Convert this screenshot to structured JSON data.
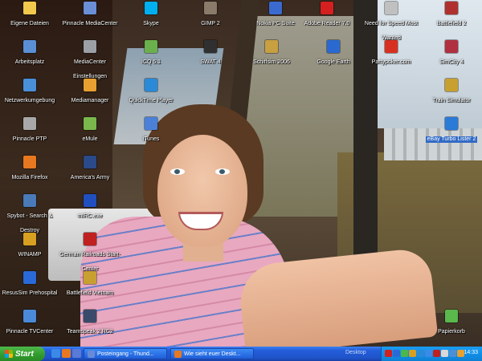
{
  "desktop_icons": [
    {
      "label": "Eigene Dateien",
      "color": "#f2c94c"
    },
    {
      "label": "Pinnacle MediaCenter",
      "color": "#6a8fd6"
    },
    {
      "label": "Skype",
      "color": "#00aff0"
    },
    {
      "label": "GIMP 2",
      "color": "#8a7a6a"
    },
    {
      "label": "Nokia PC Suite",
      "color": "#3a6ad0"
    },
    {
      "label": "Adobe Reader 7.0",
      "color": "#d42020"
    },
    {
      "label": "Need for Speed Most Wanted",
      "color": "#c0c0c0"
    },
    {
      "label": "Battlefield 2",
      "color": "#b03030"
    },
    {
      "label": "Arbeitsplatz",
      "color": "#5a8fd6"
    },
    {
      "label": "MediaCenter Einstellungen",
      "color": "#9aa0a6"
    },
    {
      "label": "ICQ 5.1",
      "color": "#6ab04c"
    },
    {
      "label": "SWAT 4",
      "color": "#303030"
    },
    {
      "label": "Schiffsim 2006",
      "color": "#c8a040"
    },
    {
      "label": "Google Earth",
      "color": "#2a6ad0"
    },
    {
      "label": "Partypoker.com",
      "color": "#d83020"
    },
    {
      "label": "SimCity 4",
      "color": "#b03040"
    },
    {
      "label": "Netzwerkumgebung",
      "color": "#4a90d9"
    },
    {
      "label": "Mediamanager",
      "color": "#e8a030"
    },
    {
      "label": "QuickTime Player",
      "color": "#2a8ad8"
    },
    {
      "label": "Train Simulator",
      "color": "#c8a030"
    },
    {
      "label": "Pinnacle PTP",
      "color": "#a8a8a8"
    },
    {
      "label": "eMule",
      "color": "#7ab84c"
    },
    {
      "label": "iTunes",
      "color": "#4a80d8"
    },
    {
      "label": "eBay Turbo Lister 2",
      "color": "#2a7ad8"
    },
    {
      "label": "Mozilla Firefox",
      "color": "#e87820"
    },
    {
      "label": "America's Army",
      "color": "#2a4a8a"
    },
    {
      "label": "Spybot - Search & Destroy",
      "color": "#4a7ab8"
    },
    {
      "label": "mIRC.exe",
      "color": "#2050c0"
    },
    {
      "label": "WINAMP",
      "color": "#d8a020"
    },
    {
      "label": "German Railroads Start-Center",
      "color": "#c02020"
    },
    {
      "label": "ResusSim Prehospital",
      "color": "#2a6ad8"
    },
    {
      "label": "Battlefield Vietnam",
      "color": "#c8a030"
    },
    {
      "label": "Pinnacle TVCenter",
      "color": "#4a8ad8"
    },
    {
      "label": "Teamspeak 2 RC2",
      "color": "#3a4a6a"
    },
    {
      "label": "Papierkorb",
      "color": "#5ab84c"
    }
  ],
  "taskbar": {
    "start_label": "Start",
    "quicklaunch": [
      {
        "name": "ie-icon",
        "color": "#3a8ae8"
      },
      {
        "name": "firefox-icon",
        "color": "#e87820"
      },
      {
        "name": "thunderbird-icon",
        "color": "#5a7ad8"
      }
    ],
    "tasks": [
      {
        "label": "Posteingang - Thund...",
        "color": "#6a8ad8"
      },
      {
        "label": "Wie sieht euer Deskt...",
        "color": "#e87820"
      }
    ],
    "desktop_label": "Desktop",
    "tray_colors": [
      "#d02020",
      "#2a6ad8",
      "#4ab84c",
      "#d8a020",
      "#2a8ad8",
      "#3a8ae8",
      "#c02020",
      "#d8d8d8",
      "#4a90d9",
      "#e8a030"
    ],
    "clock": "14:33"
  }
}
